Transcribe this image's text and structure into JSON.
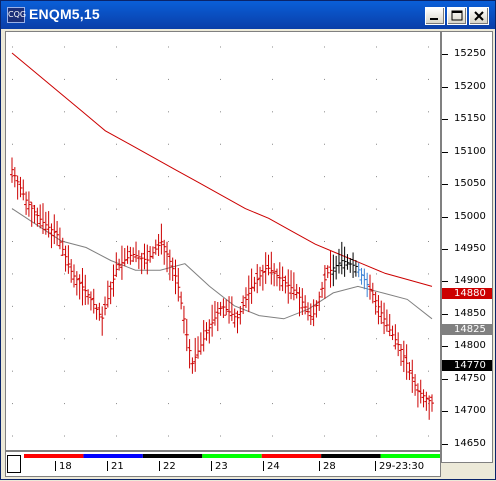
{
  "window": {
    "title": "ENQM5,15",
    "app_icon_text": "CQG"
  },
  "y_axis": {
    "labels": [
      "15250",
      "15200",
      "15150",
      "15100",
      "15050",
      "15000",
      "14950",
      "14900",
      "14850",
      "14800",
      "14750",
      "14700",
      "14650"
    ],
    "flags": [
      {
        "text": "14880",
        "color": "#cc0000"
      },
      {
        "text": "14825",
        "color": "#808080"
      },
      {
        "text": "14770",
        "color": "#000000"
      }
    ]
  },
  "x_axis": {
    "labels": [
      "18",
      "21",
      "22",
      "23",
      "24",
      "28",
      "29-23:30"
    ],
    "segment_colors": [
      "#ff0000",
      "#0000ff",
      "#000000",
      "#00ff00",
      "#ff0000",
      "#000000",
      "#00ff00"
    ]
  },
  "chart_data": {
    "type": "bar",
    "title": "ENQM5,15",
    "ylim": [
      14640,
      15260
    ],
    "series": [
      {
        "name": "",
        "color": "#cc0000",
        "values": [
          15240,
          15210,
          15180,
          15150,
          15120,
          15100,
          15080,
          15060,
          15040,
          15020,
          15000,
          14985,
          14965,
          14945,
          14930,
          14915,
          14900,
          14890,
          14880
        ]
      },
      {
        "name": "",
        "color": "#808080",
        "values": [
          15000,
          14975,
          14950,
          14940,
          14920,
          14905,
          14905,
          14915,
          14880,
          14850,
          14835,
          14830,
          14845,
          14870,
          14880,
          14870,
          14860,
          14830
        ]
      },
      {
        "name": "",
        "color": "#000000",
        "values": [
          15060,
          15010,
          14980,
          14960,
          14900,
          14870,
          14830,
          14910,
          14930,
          14920,
          14950,
          14890,
          14760,
          14810,
          14850,
          14830,
          14880,
          14910,
          14890,
          14870,
          14830,
          14900,
          14920,
          14910,
          14870,
          14820,
          14780,
          14720,
          14700
        ]
      }
    ]
  }
}
